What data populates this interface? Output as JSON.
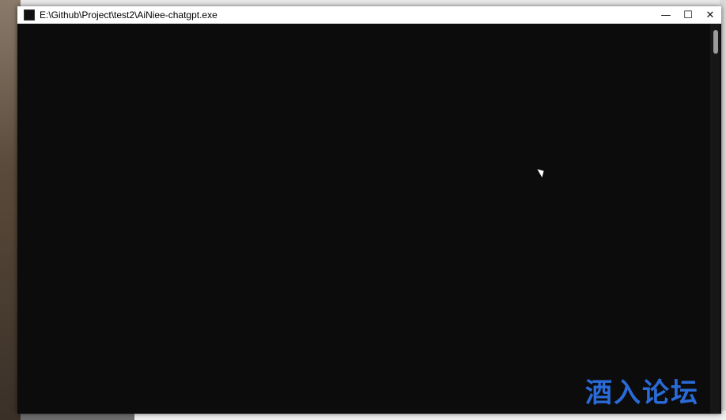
{
  "titlebar": {
    "title": "E:\\Github\\Project\\test2\\AiNiee-chatgpt.exe",
    "minimize": "—",
    "maximize": "☐",
    "close": "✕"
  },
  "logo": "酒入论坛"
}
